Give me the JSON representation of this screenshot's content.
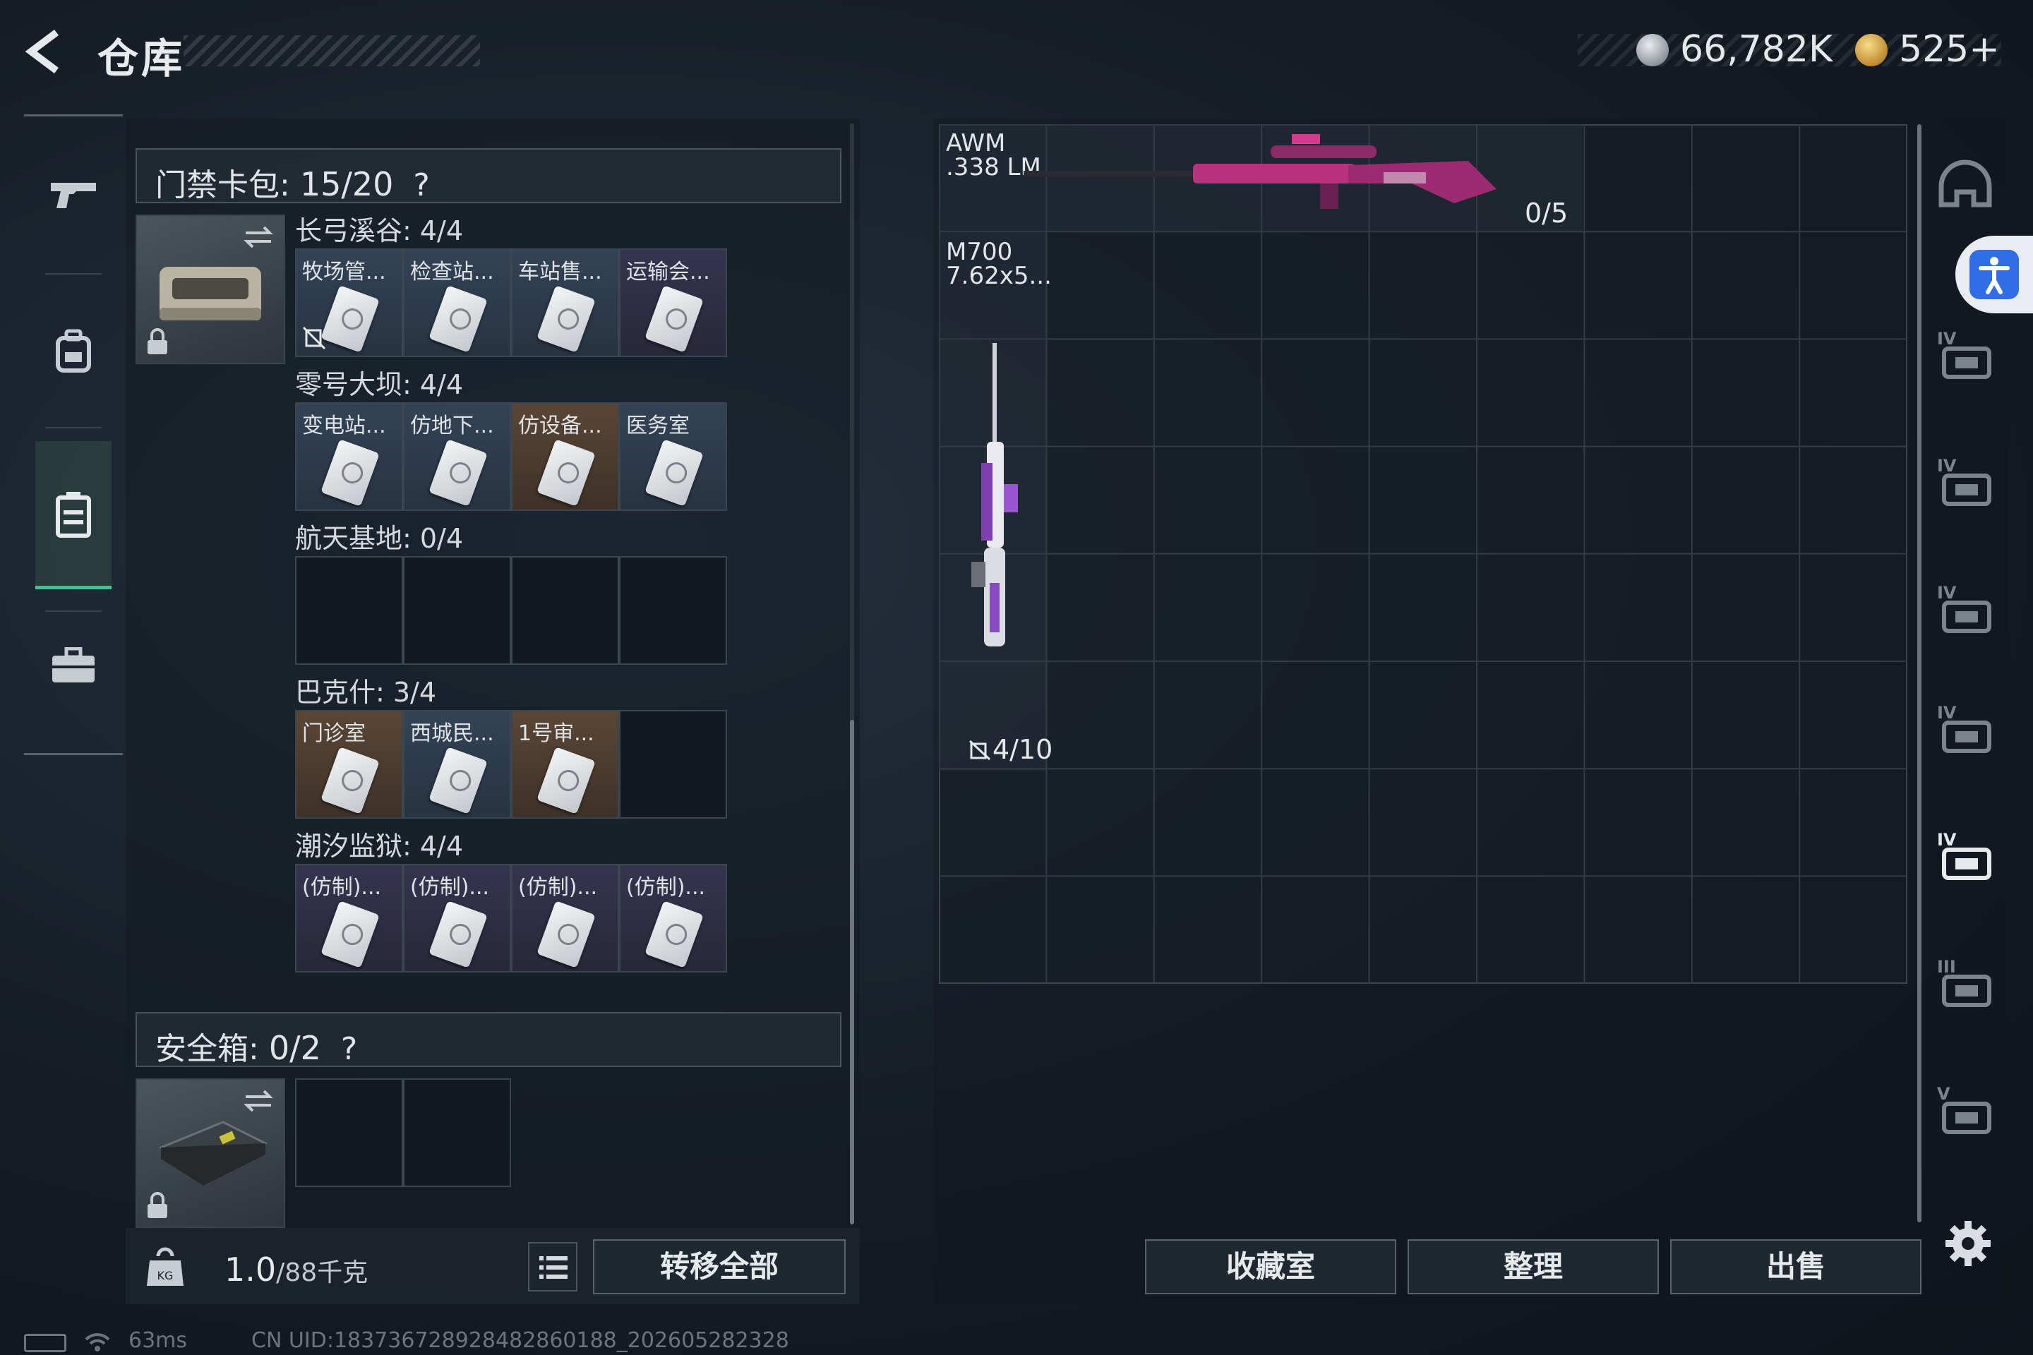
{
  "header": {
    "title": "仓库",
    "currency": [
      {
        "icon": "silver-coin-icon",
        "value": "66,782K"
      },
      {
        "icon": "gold-coin-icon",
        "value": "525+"
      }
    ]
  },
  "left_nav": {
    "items": [
      {
        "icon": "gun-icon"
      },
      {
        "icon": "backpack-icon"
      },
      {
        "icon": "case-icon",
        "active": true
      },
      {
        "icon": "toolbox-icon"
      }
    ]
  },
  "keycard_pack": {
    "label": "门禁卡包:",
    "count": "15/20",
    "help": "?",
    "groups": [
      {
        "label": "长弓溪谷: 4/4",
        "slots": [
          {
            "label": "牧场管...",
            "tone": "blue"
          },
          {
            "label": "检查站...",
            "tone": "blue"
          },
          {
            "label": "车站售...",
            "tone": "blue"
          },
          {
            "label": "运输会...",
            "tone": "purple"
          }
        ]
      },
      {
        "label": "零号大坝: 4/4",
        "slots": [
          {
            "label": "变电站...",
            "tone": "blue"
          },
          {
            "label": "仿地下...",
            "tone": "blue"
          },
          {
            "label": "仿设备...",
            "tone": "gold"
          },
          {
            "label": "医务室",
            "tone": "blue"
          }
        ]
      },
      {
        "label": "航天基地: 0/4",
        "slots": [
          {
            "label": "",
            "tone": "empty"
          },
          {
            "label": "",
            "tone": "empty"
          },
          {
            "label": "",
            "tone": "empty"
          },
          {
            "label": "",
            "tone": "empty"
          }
        ]
      },
      {
        "label": "巴克什: 3/4",
        "slots": [
          {
            "label": "门诊室",
            "tone": "gold"
          },
          {
            "label": "西城民...",
            "tone": "blue"
          },
          {
            "label": "1号审...",
            "tone": "gold"
          },
          {
            "label": "",
            "tone": "empty"
          }
        ]
      },
      {
        "label": "潮汐监狱: 4/4",
        "slots": [
          {
            "label": "(仿制)...",
            "tone": "purple"
          },
          {
            "label": "(仿制)...",
            "tone": "purple"
          },
          {
            "label": "(仿制)...",
            "tone": "purple"
          },
          {
            "label": "(仿制)...",
            "tone": "purple"
          }
        ]
      }
    ]
  },
  "safe_box": {
    "label": "安全箱:",
    "count": "0/2",
    "help": "?"
  },
  "weight": {
    "value": "1.0",
    "max": "/88千克"
  },
  "buttons": {
    "transfer_all": "转移全部",
    "collection": "收藏室",
    "organize": "整理",
    "sell": "出售"
  },
  "weapons": [
    {
      "name": "AWM",
      "ammo": ".338 LM",
      "count": "0/5"
    },
    {
      "name": "M700",
      "ammo": "7.62x5...",
      "count": "4/10"
    }
  ],
  "right_categories": [
    {
      "icon": "helmet-icon"
    },
    {
      "icon": "armor-iv-icon-1",
      "tier": "IV"
    },
    {
      "icon": "armor-iv-icon-2",
      "tier": "IV"
    },
    {
      "icon": "chest-rig-iv-icon-1",
      "tier": "IV"
    },
    {
      "icon": "chest-rig-iv-icon-2",
      "tier": "IV"
    },
    {
      "icon": "rifle-iv-icon",
      "tier": "IV"
    },
    {
      "icon": "rifle-iii-icon",
      "tier": "III"
    },
    {
      "icon": "device-v-icon",
      "tier": "V"
    }
  ],
  "status": {
    "ping": "63ms",
    "uid": "CN UID:18373672892848286018​8_202605282328"
  },
  "colors": {
    "accent_green": "#3ec48f",
    "access_blue": "#2f6ee6"
  }
}
